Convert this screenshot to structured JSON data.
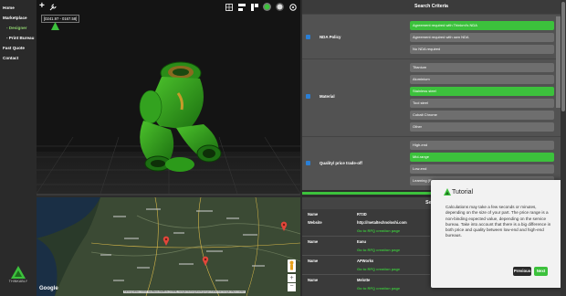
{
  "sidebar": {
    "items": [
      {
        "label": "Home"
      },
      {
        "label": "Marketplace"
      },
      {
        "label": "- Designer"
      },
      {
        "label": "- Print Bureau"
      },
      {
        "label": "Fast Quote"
      },
      {
        "label": "Contact"
      }
    ],
    "logo_text": "THINKABLY"
  },
  "viewer": {
    "add_icon": "+",
    "settings_icon": "wrench",
    "coords": "[0241.97 - 0167.58]",
    "toolbar_icons": [
      "grid-icon",
      "layers-icon",
      "slice-icon",
      "shading-icon",
      "render-icon",
      "settings-icon"
    ]
  },
  "map": {
    "google_label": "Google",
    "attribution": "Kartengrafiken ©2017 GeoBasis-DE/BKG (©2009), Google   Nutzungsbedingungen   Fehler bei Google Maps melden",
    "zoom_in": "+",
    "zoom_out": "−"
  },
  "criteria": {
    "title": "Search Criteria",
    "groups": [
      {
        "label": "NDA Policy",
        "options": [
          {
            "text": "Agreement required with Thinkmi's NDA",
            "selected": true
          },
          {
            "text": "Agreement required with own NDA",
            "selected": false
          },
          {
            "text": "No NDA required",
            "selected": false
          }
        ]
      },
      {
        "label": "Material",
        "options": [
          {
            "text": "Titanium",
            "selected": false
          },
          {
            "text": "Aluminium",
            "selected": false
          },
          {
            "text": "Stainless steel",
            "selected": true
          },
          {
            "text": "Tool steel",
            "selected": false
          },
          {
            "text": "Cobalt Chrome",
            "selected": false
          },
          {
            "text": "Other",
            "selected": false
          }
        ]
      },
      {
        "label": "Quality/ price trade-off",
        "options": [
          {
            "text": "High-end",
            "selected": false
          },
          {
            "text": "Mid-range",
            "selected": true
          },
          {
            "text": "Low-end",
            "selected": false
          },
          {
            "text": "Learning (F...",
            "selected": false
          }
        ]
      }
    ]
  },
  "services": {
    "title": "Servi",
    "rows": [
      {
        "k": "Name",
        "v": "RT3D"
      },
      {
        "k": "Website",
        "v": "http://metaltechnoloshi.com"
      },
      {
        "k": "Name",
        "v": "Eanu"
      },
      {
        "k": "Name",
        "v": "APWorks"
      },
      {
        "k": "Name",
        "v": "Melotte"
      }
    ],
    "link": "Go to RFQ creation page"
  },
  "tutorial": {
    "title": "Tutorial",
    "text": "Calculations may take a few seconds or minutes, depending on the size of your part. The price range is a non-binding expected value, depending on the service bureau. Take into account that there is a big difference in both price and quality between low-end and high-end bureaus.",
    "prev": "Previous",
    "next": "Next"
  },
  "colors": {
    "accent": "#3cc13c",
    "part": "#2f9e1c",
    "checkbox": "#2a7fd6"
  }
}
